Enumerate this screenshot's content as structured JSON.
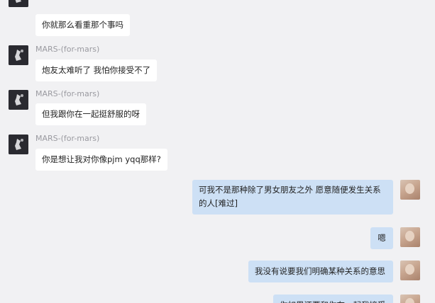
{
  "contact": {
    "name": "MARS-(for-mars)"
  },
  "messages": [
    {
      "direction": "incoming",
      "show_sender": false,
      "text": "你就那么看重那个事吗"
    },
    {
      "direction": "incoming",
      "show_sender": true,
      "text": "炮友太难听了 我怕你接受不了"
    },
    {
      "direction": "incoming",
      "show_sender": true,
      "text": "但我跟你在一起挺舒服的呀"
    },
    {
      "direction": "incoming",
      "show_sender": true,
      "text": "你是想让我对你像pjm yqq那样?"
    },
    {
      "direction": "outgoing",
      "text_line1": "可我不是那种除了男女朋友之外 愿意随便发生关系",
      "text_line2": "的人[难过]"
    },
    {
      "direction": "outgoing",
      "text": "嗯"
    },
    {
      "direction": "outgoing",
      "text": "我没有说要我们明确某种关系的意思"
    },
    {
      "direction": "outgoing",
      "text": "你如果还要和你在一起我接受"
    }
  ],
  "colors": {
    "background": "#f1f1f3",
    "incoming_bubble": "#ffffff",
    "outgoing_bubble": "#cde0f5",
    "sender_name": "#9a9aa0"
  }
}
